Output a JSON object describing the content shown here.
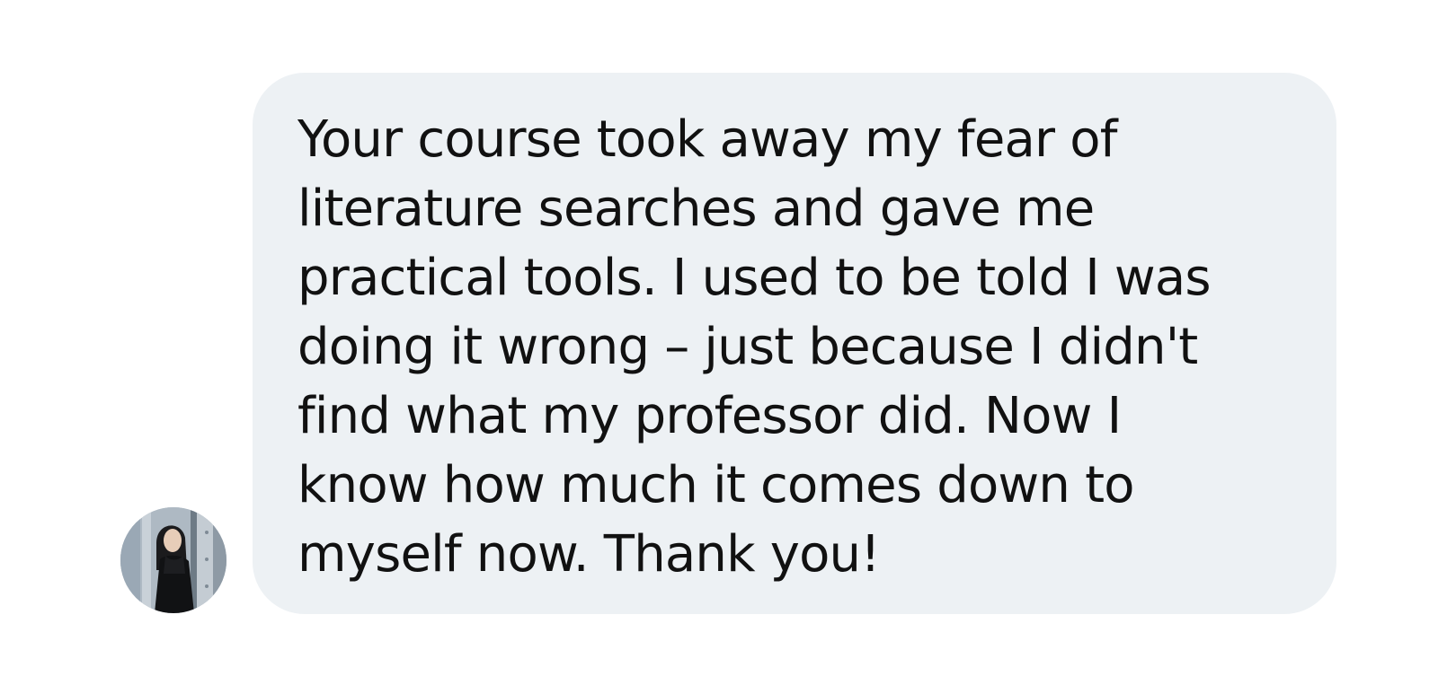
{
  "message": {
    "text": "Your course took away my fear of\nliterature searches and gave me\npractical tools. I used to be told I was\ndoing it wrong – just because I didn't\nfind what my professor did. Now I\nknow how much it comes down to\nmyself now. Thank you!",
    "bubble_color": "#edf1f4",
    "text_color": "#111111"
  },
  "sender": {
    "avatar_icon": "person-photo-avatar"
  }
}
